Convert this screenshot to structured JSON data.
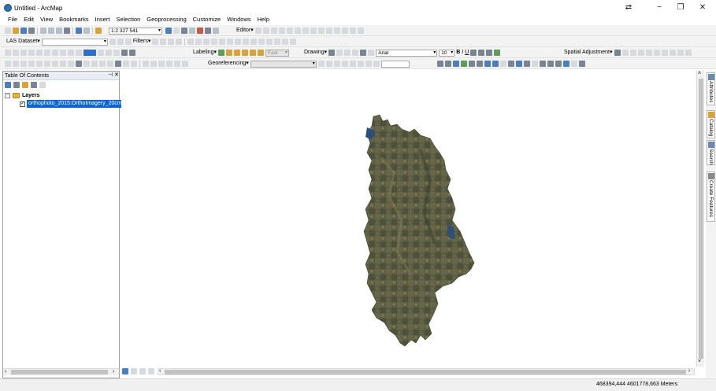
{
  "window": {
    "title": "Untitled - ArcMap",
    "minimize": "−",
    "restore": "❐",
    "close": "✕",
    "extra": "⇄"
  },
  "menu": [
    "File",
    "Edit",
    "View",
    "Bookmarks",
    "Insert",
    "Selection",
    "Geoprocessing",
    "Customize",
    "Windows",
    "Help"
  ],
  "toolbar1": {
    "scale_value": "1:2 327 541",
    "editor_label": "Editor▾"
  },
  "toolbar2": {
    "las_label": "LAS Dataset▾",
    "filters_label": "Filters▾"
  },
  "toolbar3": {
    "labeling_label": "Labeling▾",
    "fast_label": "Fast",
    "drawing_label": "Drawing▾",
    "font_value": "Arial",
    "font_size": "10",
    "bold": "B",
    "italic": "I",
    "underline": "U",
    "spatial_adjustment_label": "Spatial Adjustment▾"
  },
  "toolbar4": {
    "georeferencing_label": "Georeferencing▾"
  },
  "toc": {
    "title": "Table Of Contents",
    "pin": "⊣",
    "close": "✕",
    "layers_label": "Layers",
    "layer_name": "orthophoto_2015:OrthoImagery_20cm",
    "layer_checked": "✓",
    "expand": "−"
  },
  "side_tabs": [
    "Attributes",
    "Catalog",
    "Search",
    "Create Features"
  ],
  "status": {
    "coordinates": "468394,444  4601778,663 Meters"
  },
  "colors": {
    "selection": "#0a66d6",
    "terrain_dark": "#4a4f3a",
    "terrain_mid": "#6b6a4b",
    "water": "#2d4f7a"
  }
}
